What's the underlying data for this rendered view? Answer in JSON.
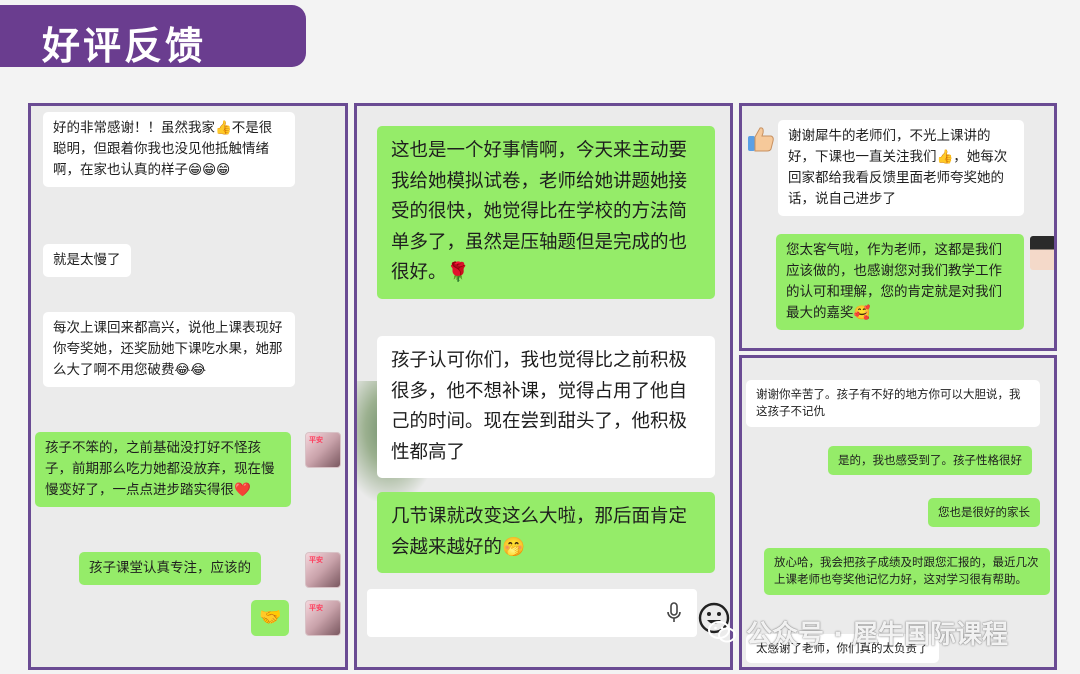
{
  "title": "好评反馈",
  "panel1": {
    "messages": [
      "好的非常感谢！！虽然我家👍不是很聪明，但跟着你我也没见他抵触情绪啊，在家也认真的样子😁😁😁",
      "就是太慢了",
      "每次上课回来都高兴，说他上课表现好你夸奖她，还奖励她下课吃水果，她那么大了啊不用您破费😂😂",
      "孩子不笨的，之前基础没打好不怪孩子，前期那么吃力她都没放弃，现在慢慢变好了，一点点进步踏实得很❤️",
      "孩子课堂认真专注，应该的",
      "🤝"
    ],
    "avatar_tag": "平安"
  },
  "panel2": {
    "messages": [
      "这也是一个好事情啊，今天来主动要我给她模拟试卷，老师给她讲题她接受的很快，她觉得比在学校的方法简单多了，虽然是压轴题但是完成的也很好。🌹",
      "孩子认可你们，我也觉得比之前积极很多，他不想补课，觉得占用了他自己的时间。现在尝到甜头了，他积极性都高了",
      "几节课就改变这么大啦，那后面肯定会越来越好的🤭"
    ]
  },
  "panel3": {
    "messages": [
      "谢谢犀牛的老师们，不光上课讲的好，下课也一直关注我们👍，她每次回家都给我看反馈里面老师夸奖她的话，说自己进步了",
      "您太客气啦，作为老师，这都是我们应该做的，也感谢您对我们教学工作的认可和理解，您的肯定就是对我们最大的嘉奖🥰"
    ]
  },
  "panel4": {
    "messages": [
      "谢谢你辛苦了。孩子有不好的地方你可以大胆说，我这孩子不记仇",
      "是的，我也感受到了。孩子性格很好",
      "您也是很好的家长",
      "放心哈，我会把孩子成绩及时跟您汇报的，最近几次上课老师也夸奖他记忆力好，这对学习很有帮助。",
      "太感谢了老师，你们真的太负责了"
    ]
  },
  "watermark": "公众号 · 犀牛国际课程",
  "colors": {
    "banner": "#6a3d8f",
    "border": "#6a4b93",
    "green_bubble": "#95ec69",
    "white_bubble": "#ffffff"
  },
  "icons": [
    "thumbs-up-icon",
    "avatar-icon",
    "handshake-icon",
    "microphone-icon",
    "smile-icon",
    "wechat-icon"
  ]
}
